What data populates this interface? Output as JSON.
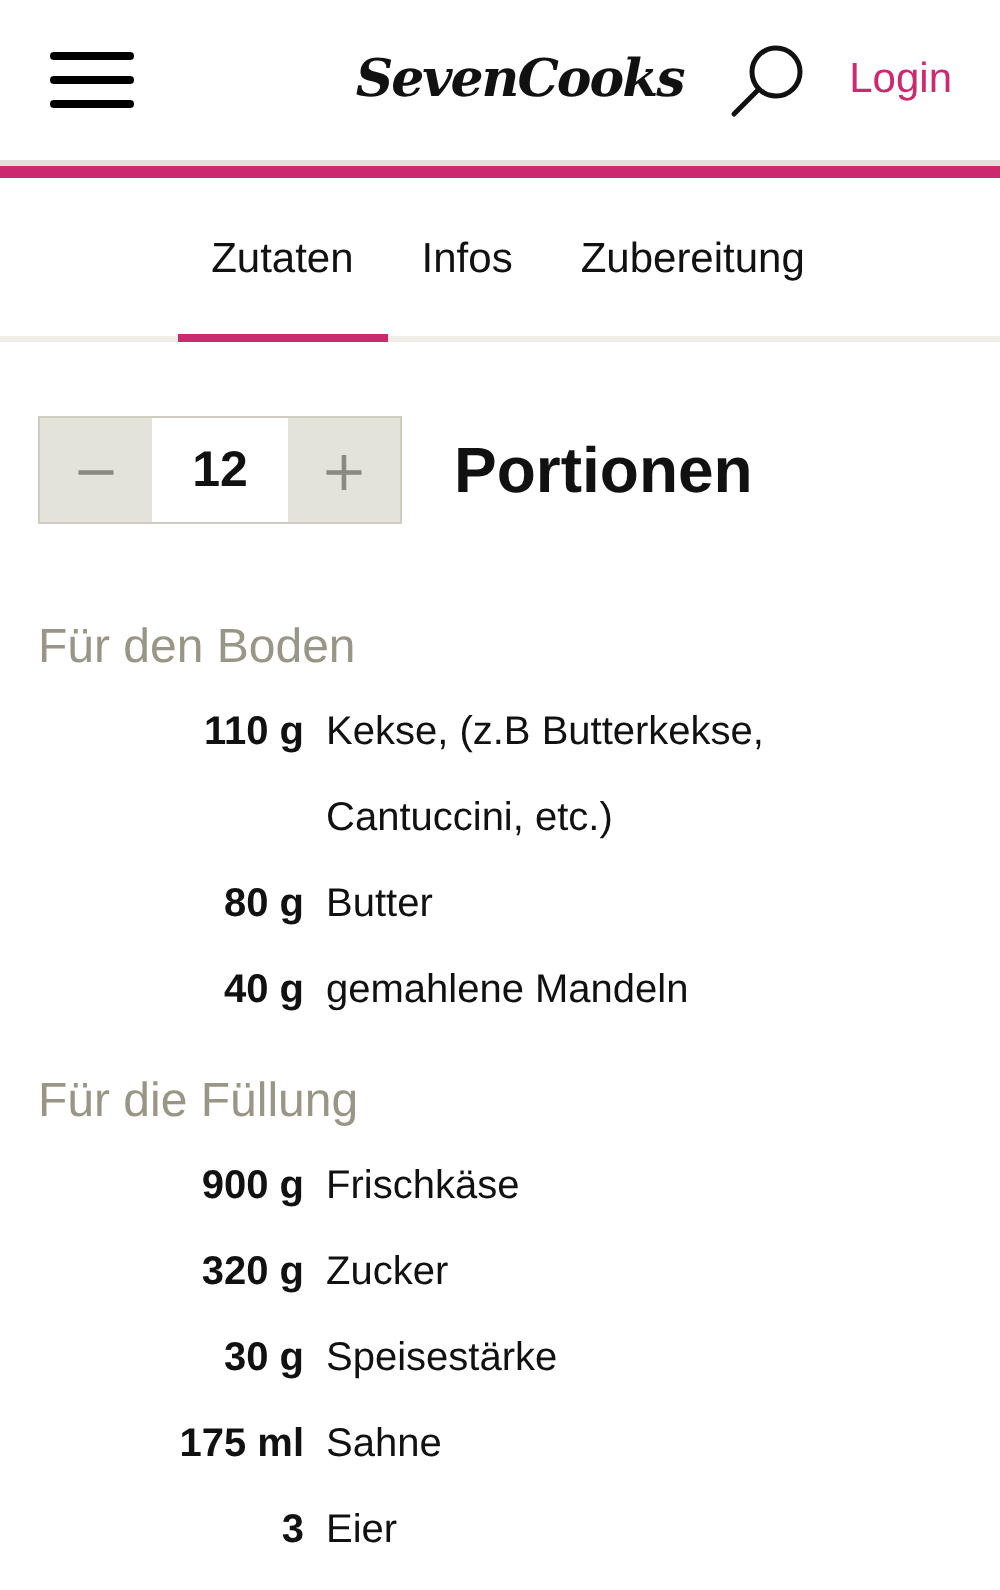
{
  "header": {
    "logo": "SevenCooks",
    "login": "Login"
  },
  "tabs": [
    {
      "label": "Zutaten",
      "selected": true
    },
    {
      "label": "Infos",
      "selected": false
    },
    {
      "label": "Zubereitung",
      "selected": false
    }
  ],
  "servings": {
    "minus": "−",
    "value": "12",
    "plus": "+",
    "label": "Portionen"
  },
  "groups": [
    {
      "title": "Für den Boden",
      "items": [
        {
          "amount": "110 g",
          "name": "Kekse, (z.B Butterkekse, Cantuccini, etc.)"
        },
        {
          "amount": "80 g",
          "name": "Butter"
        },
        {
          "amount": "40 g",
          "name": "gemahlene Mandeln"
        }
      ]
    },
    {
      "title": "Für die Füllung",
      "items": [
        {
          "amount": "900 g",
          "name": "Frischkäse"
        },
        {
          "amount": "320 g",
          "name": "Zucker"
        },
        {
          "amount": "30 g",
          "name": "Speisestärke"
        },
        {
          "amount": "175 ml",
          "name": "Sahne"
        },
        {
          "amount": "3",
          "name": "Eier"
        }
      ]
    }
  ]
}
